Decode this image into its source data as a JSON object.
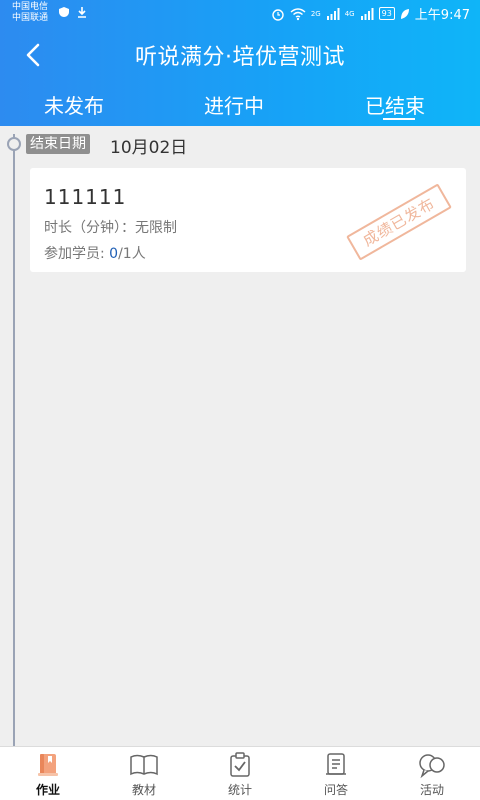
{
  "status_bar": {
    "carrier1": "中国电信",
    "carrier2": "中国联通",
    "signal1": "2G",
    "signal2": "4G",
    "battery": "93",
    "time": "上午9:47"
  },
  "header": {
    "title": "听说满分·培优营测试"
  },
  "tabs": [
    {
      "label": "未发布"
    },
    {
      "label": "进行中"
    },
    {
      "label": "已结束",
      "active": true
    }
  ],
  "group": {
    "tag": "结束日期",
    "date": "10月02日"
  },
  "card": {
    "title": "111111",
    "duration": "时长（分钟）：无限制",
    "participants_prefix": "参加学员: ",
    "participants_done": "0",
    "participants_total": "/1人",
    "stamp": "成绩已发布"
  },
  "bottom_nav": [
    {
      "label": "作业",
      "icon": "homework-icon",
      "active": true
    },
    {
      "label": "教材",
      "icon": "book-icon"
    },
    {
      "label": "统计",
      "icon": "clipboard-check-icon"
    },
    {
      "label": "问答",
      "icon": "qa-list-icon"
    },
    {
      "label": "活动",
      "icon": "chat-bubbles-icon"
    }
  ],
  "colors": {
    "header_start": "#2d8bf0",
    "header_end": "#0fb5f8",
    "stamp": "#f0b79c",
    "count": "#1f5fb5"
  }
}
